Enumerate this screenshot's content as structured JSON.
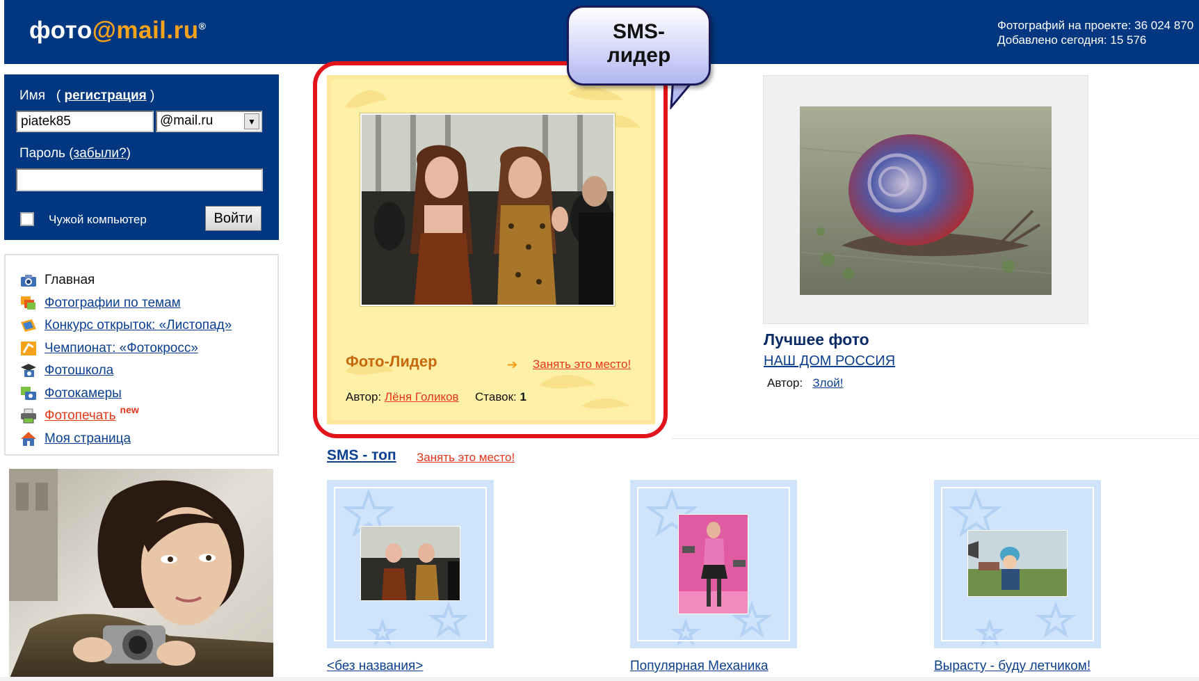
{
  "header": {
    "logo_text": "фото",
    "logo_at": "@mail",
    "logo_tld": ".ru",
    "logo_reg": "®",
    "stats_line1": "Фотографий на проекте: 36 024 870",
    "stats_line2": "Добавлено сегодня: 15 576"
  },
  "login": {
    "name_label": "Имя",
    "register_open": "(",
    "register_link": "регистрация",
    "register_close": ")",
    "name_value": "piatek85",
    "domain_value": "@mail.ru",
    "password_label": "Пароль (",
    "forgot_link": "забыли?",
    "forgot_close": ")",
    "foreign_pc_label": "Чужой компьютер",
    "submit_label": "Войти"
  },
  "menu": {
    "items": [
      {
        "label": "Главная",
        "icon": "camera-icon"
      },
      {
        "label": "Фотографии по темам",
        "icon": "photos-icon"
      },
      {
        "label": "Конкурс открыток: «Листопад»",
        "icon": "postcard-icon"
      },
      {
        "label": "Чемпионат: «Фотокросс»",
        "icon": "championship-icon"
      },
      {
        "label": "Фотошкола",
        "icon": "school-icon"
      },
      {
        "label": "Фотокамеры",
        "icon": "cameras-icon"
      },
      {
        "label": "Фотопечать",
        "icon": "printer-icon",
        "badge": "new"
      },
      {
        "label": "Моя страница",
        "icon": "home-icon"
      }
    ]
  },
  "sms_leader": {
    "bubble_line1": "SMS-",
    "bubble_line2": "лидер",
    "title": "Фото-Лидер",
    "take_place": "Занять это место!",
    "author_label": "Автор:",
    "author_name": "Лёня Голиков",
    "bids_label": "Ставок:",
    "bids_value": "1"
  },
  "best_photo": {
    "title": "Лучшее фото",
    "link": "НАШ ДОМ РОССИЯ",
    "author_label": "Автор:",
    "author_name": "Злой!"
  },
  "sms_top": {
    "title": "SMS - топ",
    "take_place": "Занять это место!",
    "cards": [
      {
        "caption": "<без названия>"
      },
      {
        "caption": "Популярная Механика"
      },
      {
        "caption": "Вырасту - буду летчиком!"
      }
    ]
  },
  "colors": {
    "brand_blue": "#003780",
    "accent_orange": "#f7a21b",
    "link_red": "#e5361a",
    "leader_frame": "#e3131b"
  }
}
